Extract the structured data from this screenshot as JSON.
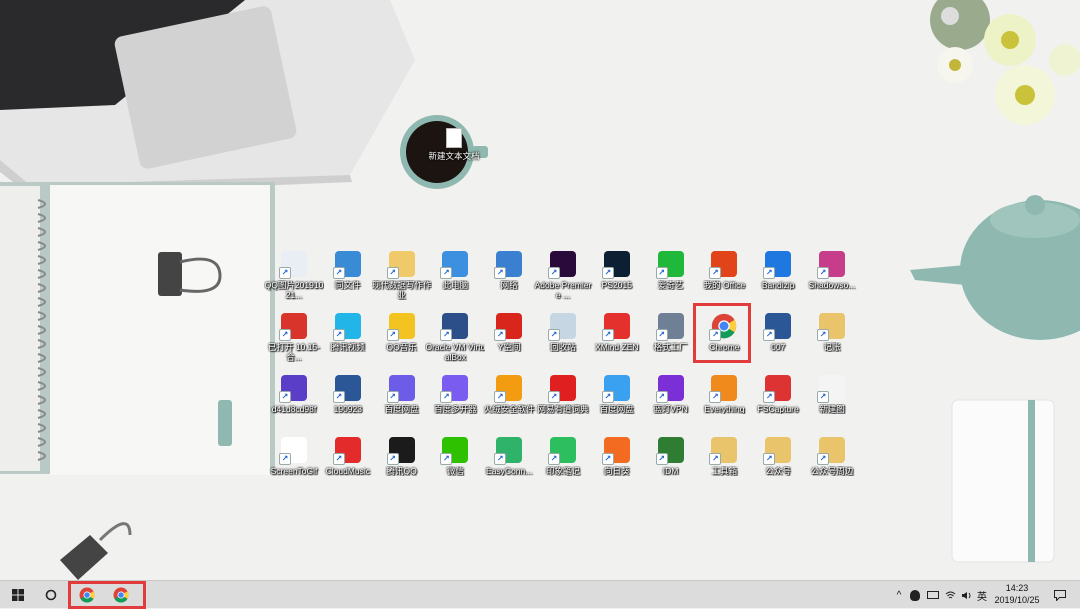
{
  "desktop": {
    "coffee_file": {
      "label": "新建文本文档",
      "icon": "text-file-icon"
    },
    "icons": [
      {
        "label": "QQ图片20191021...",
        "icon": "image-file-icon",
        "color": "#e9eef5"
      },
      {
        "label": "同文件",
        "icon": "contact-folder-icon",
        "color": "#3a8bd6"
      },
      {
        "label": "现代数据写作作业",
        "icon": "document-folder-icon",
        "color": "#f0c96a"
      },
      {
        "label": "此电脑",
        "icon": "computer-icon",
        "color": "#3d8fe0"
      },
      {
        "label": "网络",
        "icon": "network-icon",
        "color": "#3a7fd0"
      },
      {
        "label": "Adobe Premiere ...",
        "icon": "premiere-icon",
        "color": "#2a0a3a"
      },
      {
        "label": "PS2015",
        "icon": "photoshop-icon",
        "color": "#0d1f33"
      },
      {
        "label": "爱奇艺",
        "icon": "iqiyi-icon",
        "color": "#1fb83a"
      },
      {
        "label": "我的 Office",
        "icon": "office-icon",
        "color": "#e2441a"
      },
      {
        "label": "Bandizip",
        "icon": "bandizip-icon",
        "color": "#1f77e0"
      },
      {
        "label": "Shadowso...",
        "icon": "shadowsocks-icon",
        "color": "#c83d8a"
      },
      {
        "label": "已打开 10.15-合...",
        "icon": "pdf-icon",
        "color": "#d9342b"
      },
      {
        "label": "腾讯视频",
        "icon": "tencent-video-icon",
        "color": "#22b6e8"
      },
      {
        "label": "QQ音乐",
        "icon": "qq-music-icon",
        "color": "#f3c322"
      },
      {
        "label": "Oracle VM VirtualBox",
        "icon": "virtualbox-icon",
        "color": "#2c4f8a"
      },
      {
        "label": "Y空间",
        "icon": "y-space-icon",
        "color": "#d9261c"
      },
      {
        "label": "回收站",
        "icon": "recycle-bin-icon",
        "color": "#c7d6e3"
      },
      {
        "label": "XMind ZEN",
        "icon": "xmind-icon",
        "color": "#e5312d"
      },
      {
        "label": "格式工厂",
        "icon": "format-factory-icon",
        "color": "#6f7f95"
      },
      {
        "label": "Chrome",
        "icon": "chrome-icon",
        "color": "#4285f4"
      },
      {
        "label": "007",
        "icon": "word-doc-icon",
        "color": "#2b5797"
      },
      {
        "label": "记账",
        "icon": "folder-icon",
        "color": "#e9c46a"
      },
      {
        "label": "d41d8cd98f",
        "icon": "image-thumb-icon",
        "color": "#5a3ec8"
      },
      {
        "label": "190923",
        "icon": "word-doc-icon",
        "color": "#2b5797"
      },
      {
        "label": "百度网盘",
        "icon": "baidu-netdisk-icon",
        "color": "#6c5ce7"
      },
      {
        "label": "百度多开器",
        "icon": "multi-open-icon",
        "color": "#7b5cf0"
      },
      {
        "label": "火绒安全软件",
        "icon": "huorong-icon",
        "color": "#f39c12"
      },
      {
        "label": "网易有道词典",
        "icon": "youdao-icon",
        "color": "#e02020"
      },
      {
        "label": "百度网盘",
        "icon": "baidu-cloud-icon",
        "color": "#3aa0f0"
      },
      {
        "label": "蓝灯VPN",
        "icon": "vpn-icon",
        "color": "#7b2fd6"
      },
      {
        "label": "Everything",
        "icon": "everything-icon",
        "color": "#f08a1c"
      },
      {
        "label": "FSCapture",
        "icon": "fscapture-icon",
        "color": "#d33"
      },
      {
        "label": "新建图",
        "icon": "blank-file-icon",
        "color": "#f4f4f4"
      },
      {
        "label": "ScreenToGif",
        "icon": "screentogif-icon",
        "color": "#ffffff"
      },
      {
        "label": "CloudMusic",
        "icon": "cloudmusic-icon",
        "color": "#e42b2b"
      },
      {
        "label": "腾讯QQ",
        "icon": "qq-icon",
        "color": "#1b1b1b"
      },
      {
        "label": "微信",
        "icon": "wechat-icon",
        "color": "#2dc100"
      },
      {
        "label": "EasyConn...",
        "icon": "easyconnect-icon",
        "color": "#2fb36a"
      },
      {
        "label": "印象笔记",
        "icon": "evernote-icon",
        "color": "#2dbe60"
      },
      {
        "label": "向日葵",
        "icon": "sunlogin-icon",
        "color": "#f36b21"
      },
      {
        "label": "IDM",
        "icon": "idm-icon",
        "color": "#2e7d32"
      },
      {
        "label": "工具箱",
        "icon": "folder-icon",
        "color": "#e9c46a"
      },
      {
        "label": "公众号",
        "icon": "folder-icon",
        "color": "#e9c46a"
      },
      {
        "label": "公众号周边",
        "icon": "folder-icon",
        "color": "#e9c46a"
      }
    ]
  },
  "taskbar": {
    "start_icon": "windows-logo-icon",
    "search_icon": "cortana-circle-icon",
    "pinned": [
      {
        "icon": "chrome-icon"
      },
      {
        "icon": "chrome-icon"
      }
    ],
    "tray": {
      "chevron": "^",
      "ime": "英",
      "time": "14:23",
      "date": "2019/10/25"
    }
  },
  "colors": {
    "highlight": "#e23b3b",
    "taskbar_bg": "#dcdcdc",
    "wallpaper_bg": "#f1f1f0",
    "teapot": "#8fb9b0"
  }
}
